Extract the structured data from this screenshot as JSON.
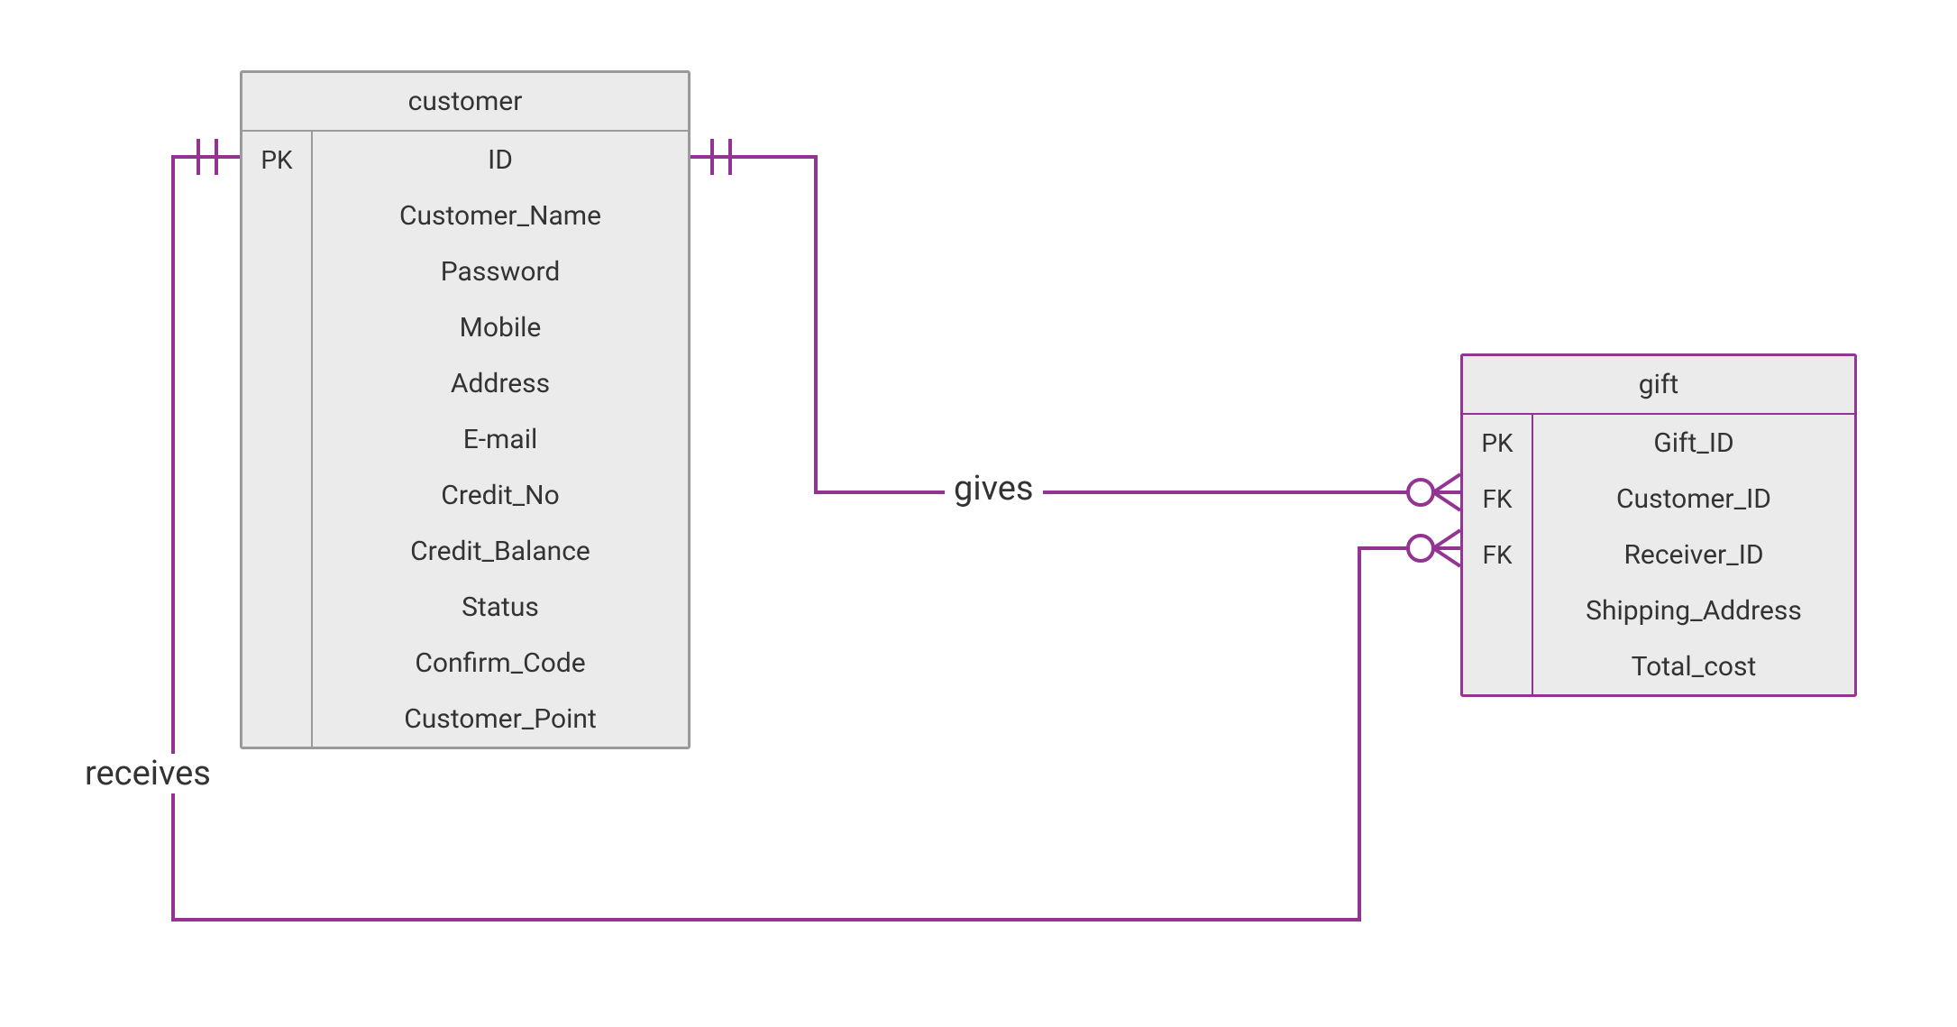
{
  "entities": {
    "customer": {
      "title": "customer",
      "keys": [
        "PK",
        "",
        "",
        "",
        "",
        "",
        "",
        "",
        "",
        "",
        ""
      ],
      "attrs": [
        "ID",
        "Customer_Name",
        "Password",
        "Mobile",
        "Address",
        "E-mail",
        "Credit_No",
        "Credit_Balance",
        "Status",
        "Confirm_Code",
        "Customer_Point"
      ]
    },
    "gift": {
      "title": "gift",
      "keys": [
        "PK",
        "FK",
        "FK",
        "",
        ""
      ],
      "attrs": [
        "Gift_ID",
        "Customer_ID",
        "Receiver_ID",
        "Shipping_Address",
        "Total_cost"
      ]
    }
  },
  "relationships": {
    "gives": "gives",
    "receives": "receives"
  },
  "colors": {
    "line": "#933392",
    "customer_border": "#9a9a9a",
    "gift_border": "#933392",
    "fill": "#ebebeb"
  }
}
